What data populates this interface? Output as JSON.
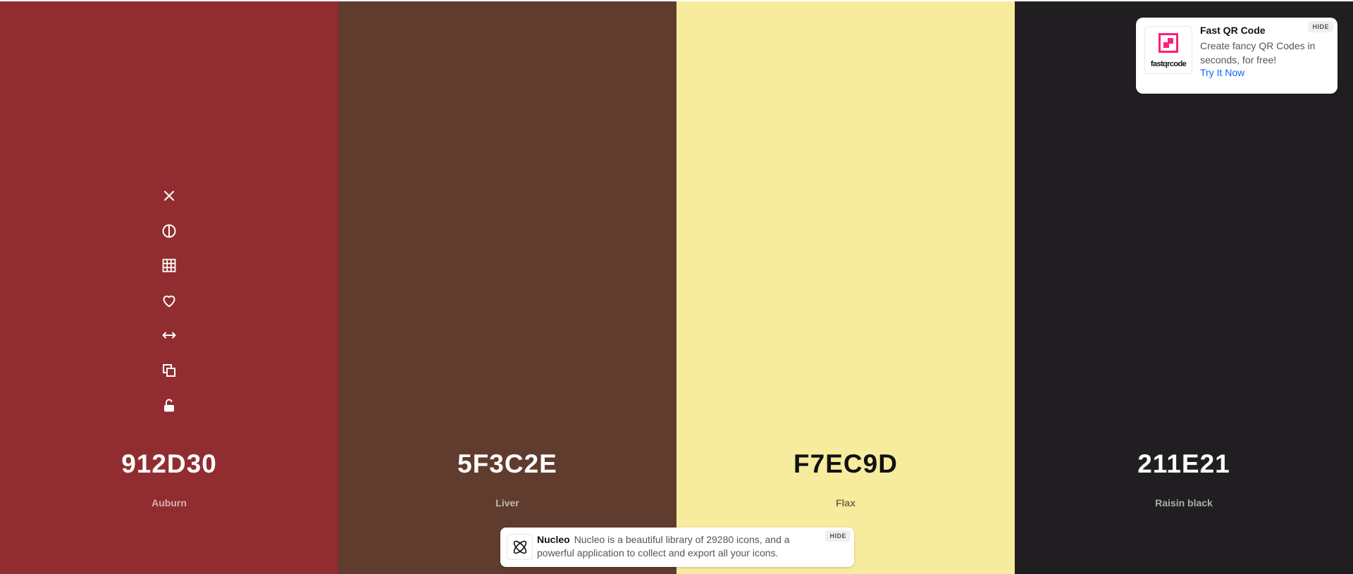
{
  "palette": {
    "swatches": [
      {
        "hex": "912D30",
        "name": "Auburn",
        "color": "#912D30"
      },
      {
        "hex": "5F3C2E",
        "name": "Liver",
        "color": "#5F3C2E"
      },
      {
        "hex": "F7EC9D",
        "name": "Flax",
        "color": "#F7EC9D"
      },
      {
        "hex": "211E21",
        "name": "Raisin black",
        "color": "#211E21"
      }
    ],
    "toolbar_icons": [
      "close-icon",
      "contrast-icon",
      "shades-grid-icon",
      "heart-icon",
      "drag-arrows-icon",
      "copy-icon",
      "unlock-icon"
    ]
  },
  "ad_top": {
    "title": "Fast QR Code",
    "description": "Create fancy QR Codes in seconds, for free!",
    "cta": "Try It Now",
    "logo_text": "fastqrcode",
    "hide_label": "HIDE",
    "accent_color": "#FF1E78"
  },
  "ad_bottom": {
    "brand": "Nucleo",
    "description": "Nucleo is a beautiful library of 29280 icons, and a powerful application to collect and export all your icons.",
    "hide_label": "HIDE"
  }
}
